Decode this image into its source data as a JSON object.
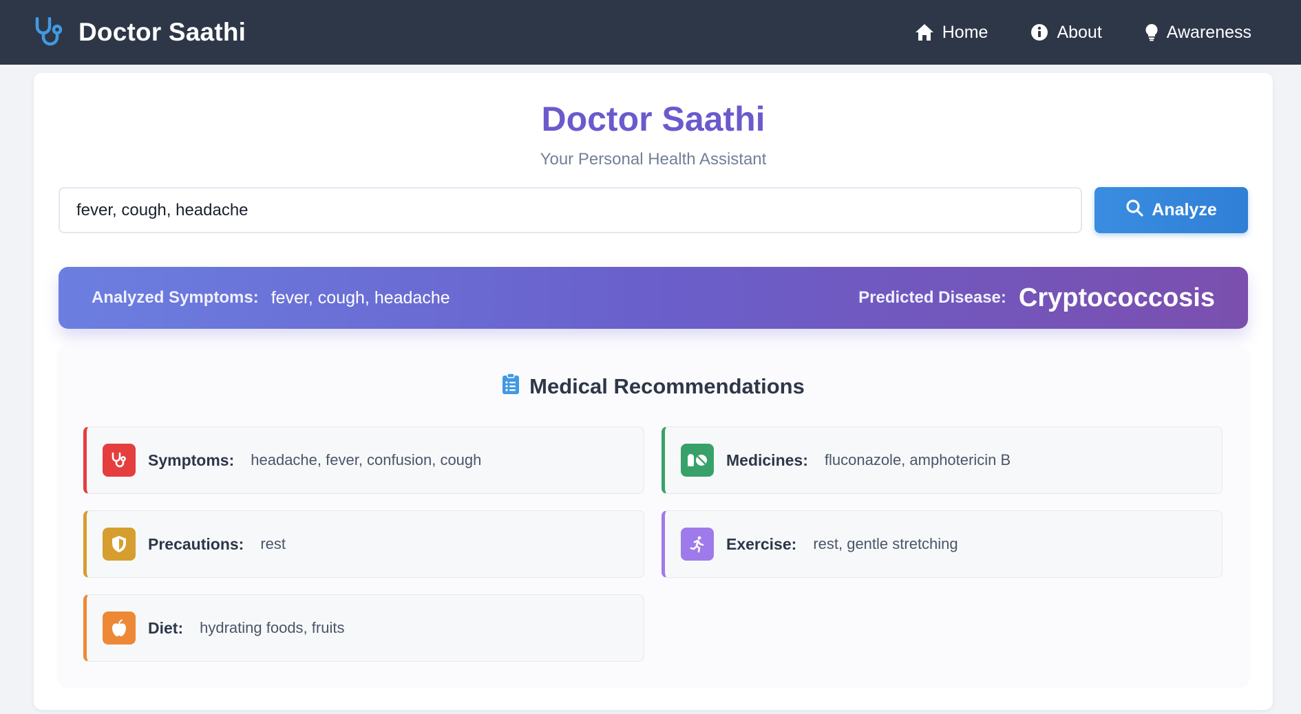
{
  "navbar": {
    "brand": "Doctor Saathi",
    "links": [
      {
        "label": "Home",
        "icon": "home-icon"
      },
      {
        "label": "About",
        "icon": "info-circle-icon"
      },
      {
        "label": "Awareness",
        "icon": "lightbulb-icon"
      }
    ]
  },
  "main": {
    "title": "Doctor Saathi",
    "subtitle": "Your Personal Health Assistant",
    "search": {
      "value": "fever, cough, headache",
      "button_label": "Analyze",
      "button_icon": "search-icon"
    }
  },
  "result": {
    "symptoms_label": "Analyzed Symptoms:",
    "symptoms_value": "fever, cough, headache",
    "disease_label": "Predicted Disease:",
    "disease_value": "Cryptococcosis"
  },
  "recommendations": {
    "heading": "Medical Recommendations",
    "heading_icon": "clipboard-list-icon",
    "items": [
      {
        "label": "Symptoms:",
        "value": "headache, fever, confusion, cough",
        "icon": "stethoscope-icon",
        "color": "#e53e3e"
      },
      {
        "label": "Medicines:",
        "value": "fluconazole, amphotericin B",
        "icon": "pills-icon",
        "color": "#38a169"
      },
      {
        "label": "Precautions:",
        "value": "rest",
        "icon": "shield-icon",
        "color": "#d69e2e"
      },
      {
        "label": "Exercise:",
        "value": "rest, gentle stretching",
        "icon": "running-icon",
        "color": "#9f7aea"
      },
      {
        "label": "Diet:",
        "value": "hydrating foods, fruits",
        "icon": "apple-icon",
        "color": "#ed8936"
      }
    ]
  },
  "colors": {
    "navbar_bg": "#2d3748",
    "title_purple": "#6a5acd",
    "button_blue": "#3182ce",
    "brand_icon_blue": "#4299e1"
  }
}
